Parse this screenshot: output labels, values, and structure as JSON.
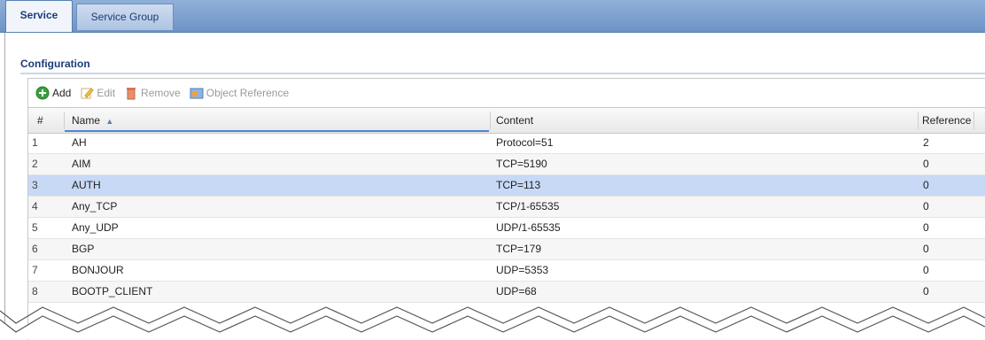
{
  "tabs": [
    {
      "label": "Service",
      "active": true
    },
    {
      "label": "Service Group",
      "active": false
    }
  ],
  "section": {
    "title": "Configuration"
  },
  "toolbar": {
    "add": "Add",
    "edit": "Edit",
    "remove": "Remove",
    "object_reference": "Object Reference"
  },
  "table": {
    "columns": {
      "num": "#",
      "name": "Name",
      "content": "Content",
      "reference": "Reference"
    },
    "sort_indicator": "▲",
    "rows": [
      {
        "num": "1",
        "name": "AH",
        "content": "Protocol=51",
        "reference": "2"
      },
      {
        "num": "2",
        "name": "AIM",
        "content": "TCP=5190",
        "reference": "0"
      },
      {
        "num": "3",
        "name": "AUTH",
        "content": "TCP=113",
        "reference": "0"
      },
      {
        "num": "4",
        "name": "Any_TCP",
        "content": "TCP/1-65535",
        "reference": "0"
      },
      {
        "num": "5",
        "name": "Any_UDP",
        "content": "UDP/1-65535",
        "reference": "0"
      },
      {
        "num": "6",
        "name": "BGP",
        "content": "TCP=179",
        "reference": "0"
      },
      {
        "num": "7",
        "name": "BONJOUR",
        "content": "UDP=5353",
        "reference": "0"
      },
      {
        "num": "8",
        "name": "BOOTP_CLIENT",
        "content": "UDP=68",
        "reference": "0"
      }
    ]
  },
  "colors": {
    "tab_text": "#1a3c78",
    "selected_row": "#c7d9f5",
    "sort_underline": "#4a86d4"
  }
}
